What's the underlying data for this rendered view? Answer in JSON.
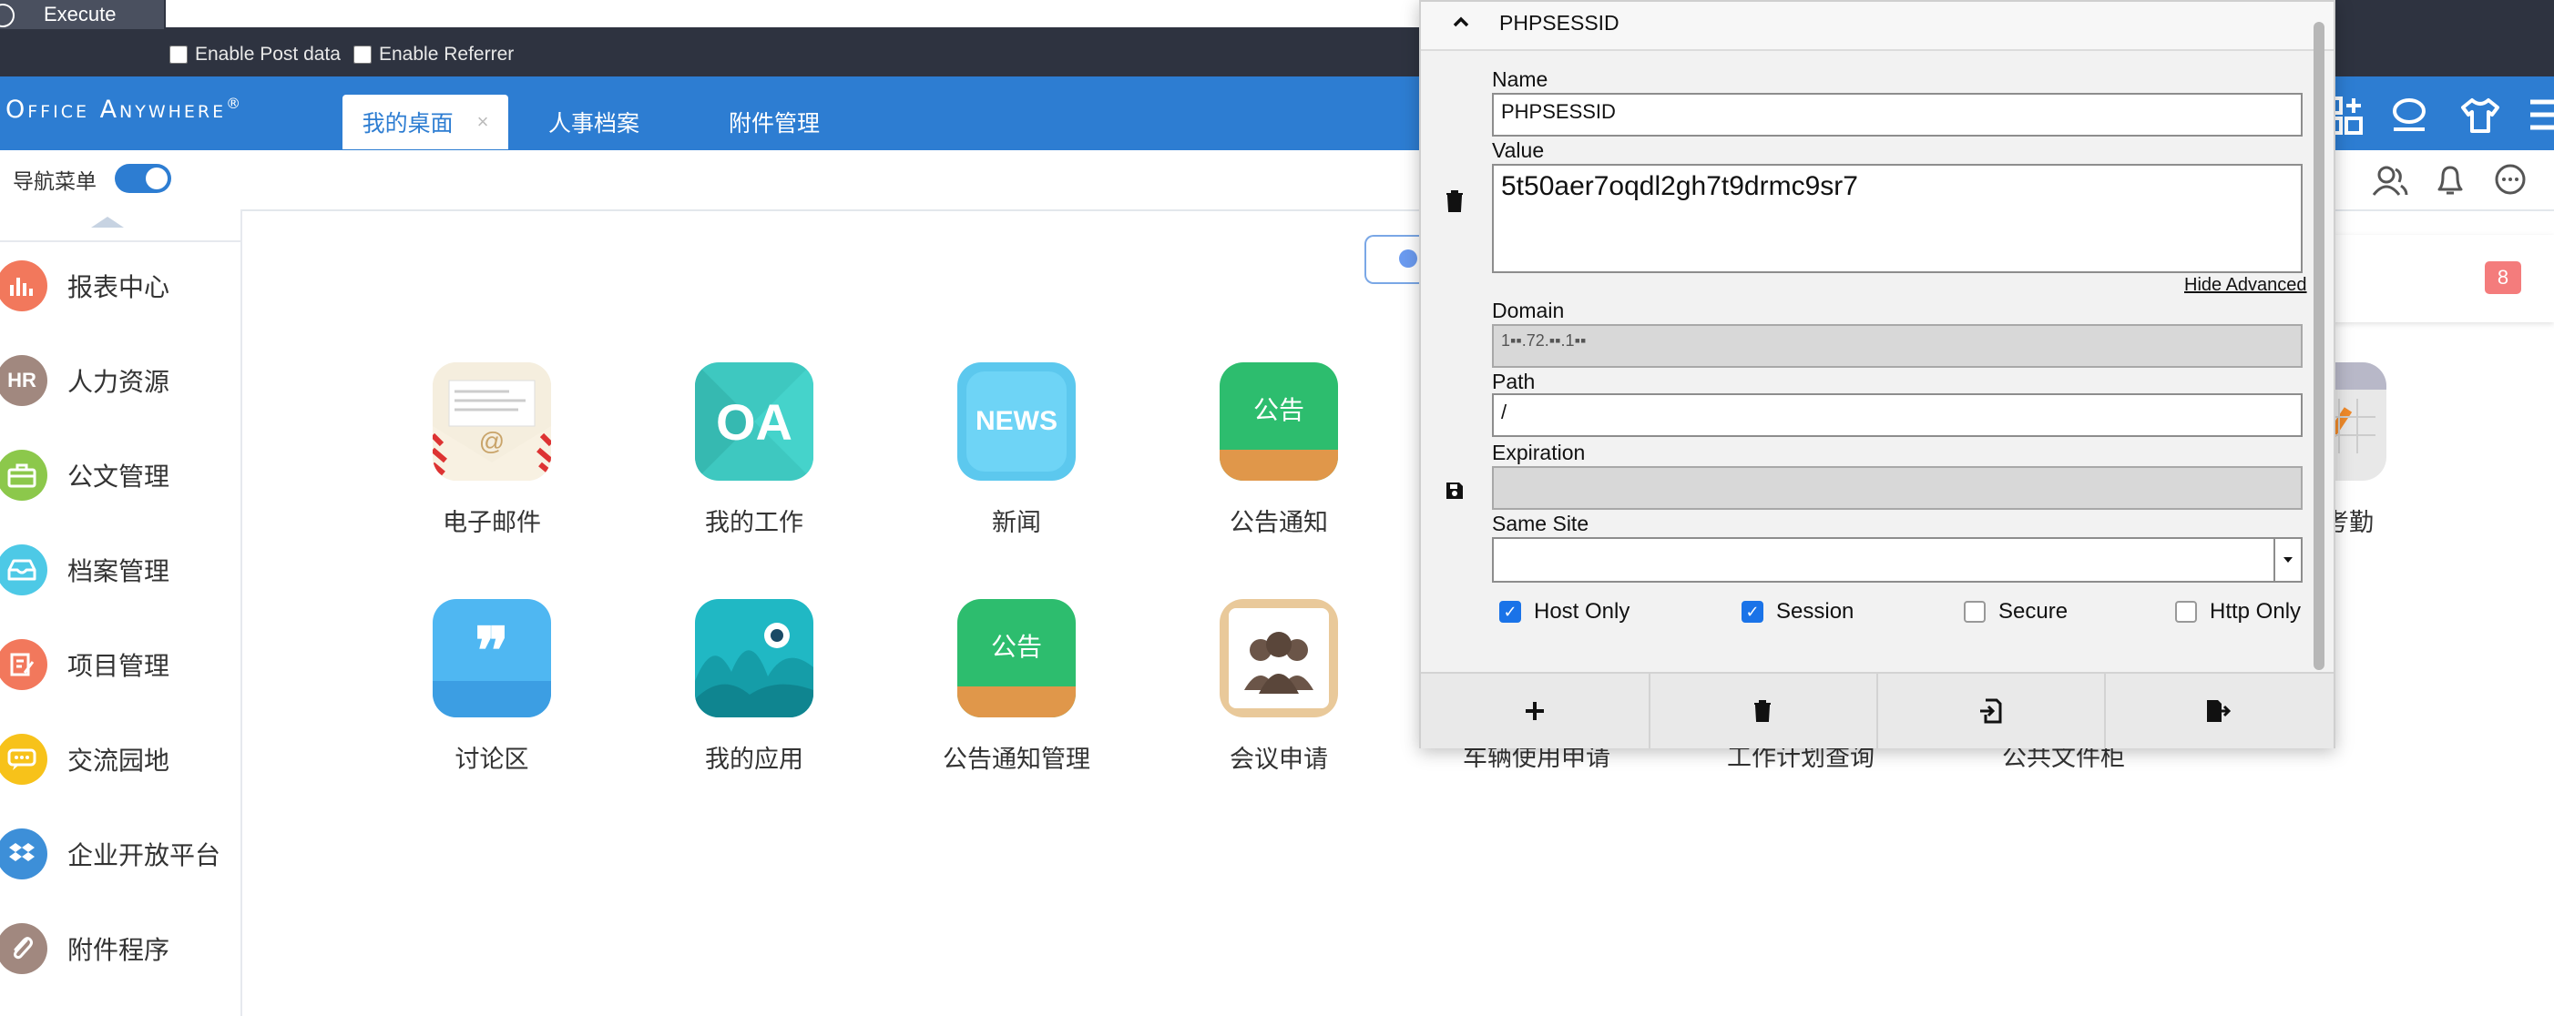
{
  "hackbar": {
    "execute_label": "Execute",
    "enable_post_label": "Enable Post data",
    "enable_referrer_label": "Enable Referrer"
  },
  "topnav": {
    "logo": "Office Anywhere",
    "logo_mark": "®",
    "tabs": [
      {
        "label": "我的桌面"
      },
      {
        "label": "人事档案"
      },
      {
        "label": "附件管理"
      }
    ],
    "close_glyph": "×"
  },
  "toolbar": {
    "nav_menu_label": "导航菜单"
  },
  "sidebar": {
    "items": [
      {
        "label": "报表中心",
        "icon": "chart-icon",
        "color": "#f2785c"
      },
      {
        "label": "人力资源",
        "icon": "hr-icon",
        "color": "#a1887f",
        "glyph": "HR"
      },
      {
        "label": "公文管理",
        "icon": "briefcase-icon",
        "color": "#8cc84b"
      },
      {
        "label": "档案管理",
        "icon": "archive-icon",
        "color": "#4dc9e6"
      },
      {
        "label": "项目管理",
        "icon": "project-icon",
        "color": "#f2785c"
      },
      {
        "label": "交流园地",
        "icon": "chat-icon",
        "color": "#f7c21a"
      },
      {
        "label": "企业开放平台",
        "icon": "dropbox-icon",
        "color": "#3d8fd8"
      },
      {
        "label": "附件程序",
        "icon": "paperclip-icon",
        "color": "#a1887f"
      }
    ]
  },
  "desktop": {
    "apps_row1": [
      {
        "label": "电子邮件",
        "icon": "email-icon"
      },
      {
        "label": "我的工作",
        "icon": "oa-icon",
        "glyph": "OA"
      },
      {
        "label": "新闻",
        "icon": "news-icon",
        "glyph": "NEWS"
      },
      {
        "label": "公告通知",
        "icon": "notice-icon",
        "glyph": "公告"
      }
    ],
    "apps_row2": [
      {
        "label": "讨论区",
        "icon": "quote-icon"
      },
      {
        "label": "我的应用",
        "icon": "apps-icon"
      },
      {
        "label": "公告通知管理",
        "icon": "notice-manage-icon",
        "glyph": "公告"
      },
      {
        "label": "会议申请",
        "icon": "meeting-icon"
      },
      {
        "label": "车辆使用申请",
        "icon": "vehicle-icon"
      },
      {
        "label": "工作计划查询",
        "icon": "plan-icon"
      },
      {
        "label": "公共文件柜",
        "icon": "cabinet-icon"
      }
    ],
    "partial_right_label": "考勤",
    "badge_count": "8"
  },
  "cookie_editor": {
    "cookie_name_header": "PHPSESSID",
    "name_label": "Name",
    "name_value": "PHPSESSID",
    "value_label": "Value",
    "value_value": "5t50aer7oqdl2gh7t9drmc9sr7",
    "hide_advanced": "Hide Advanced",
    "domain_label": "Domain",
    "domain_value": "1▪▪.72.▪▪.1▪▪",
    "path_label": "Path",
    "path_value": "/",
    "expiration_label": "Expiration",
    "expiration_value": "",
    "same_site_label": "Same Site",
    "same_site_value": "",
    "flags": [
      {
        "label": "Host Only",
        "checked": true
      },
      {
        "label": "Session",
        "checked": true
      },
      {
        "label": "Secure",
        "checked": false
      },
      {
        "label": "Http Only",
        "checked": false
      }
    ]
  }
}
